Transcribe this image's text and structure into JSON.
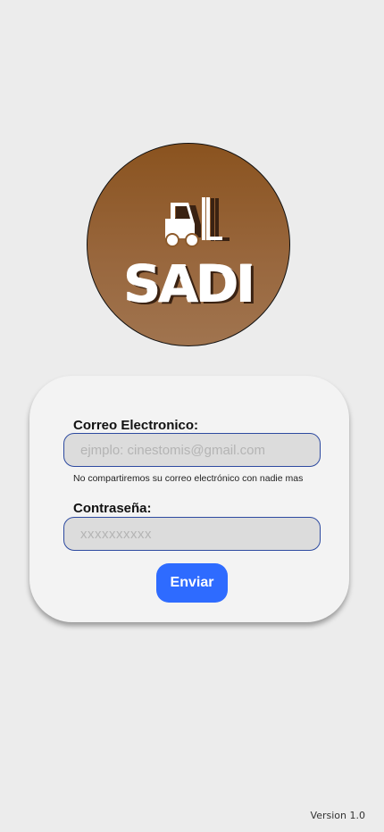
{
  "logo": {
    "text": "SADI",
    "icon": "forklift-icon",
    "gradient_top": "#8a531f",
    "gradient_bottom": "#a0744f"
  },
  "form": {
    "email_label": "Correo Electronico:",
    "email_placeholder": "ejmplo: cinestomis@gmail.com",
    "email_help": "No compartiremos su correo electrónico con nadie mas",
    "password_label": "Contraseña:",
    "password_placeholder": "xxxxxxxxxx",
    "submit_label": "Enviar"
  },
  "footer": {
    "version": "Version 1.0"
  },
  "colors": {
    "background": "#ececec",
    "card": "#f3f3f3",
    "input_fill": "#dcdcdc",
    "input_border": "#2d4aa0",
    "button": "#2e6bff"
  }
}
